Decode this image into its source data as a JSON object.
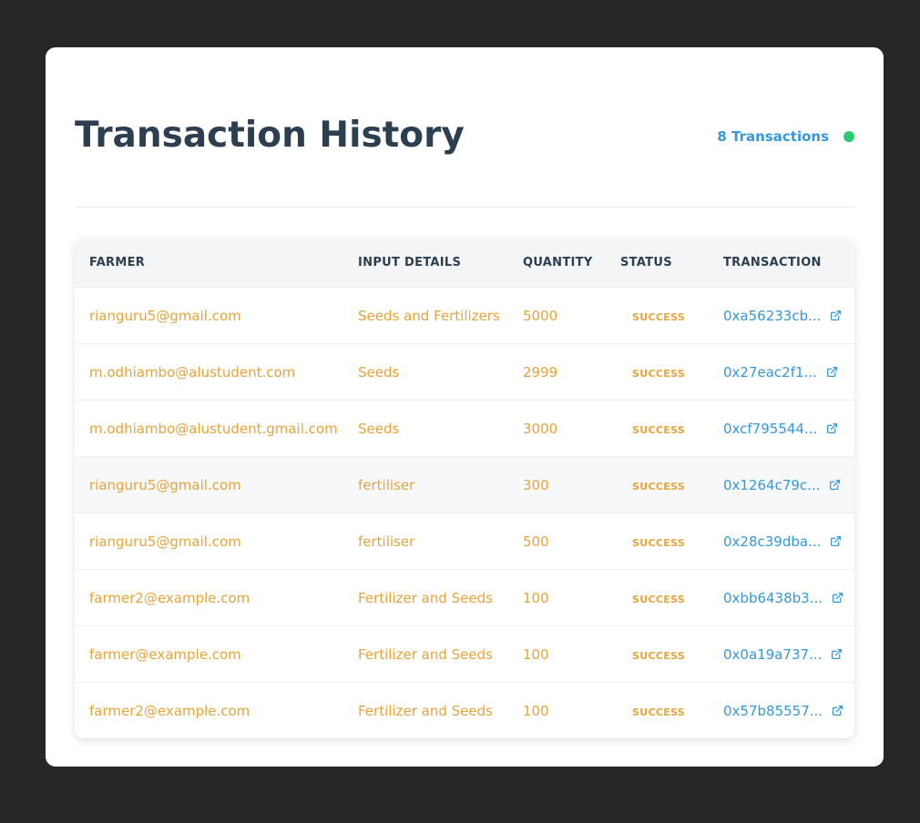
{
  "header": {
    "title": "Transaction History",
    "count_label": "8 Transactions"
  },
  "colors": {
    "page_bg": "#262626",
    "card_bg": "#ffffff",
    "title": "#2c3e50",
    "accent_blue": "#3498db",
    "accent_orange": "#e8a33a",
    "status_dot": "#2ecc71"
  },
  "table": {
    "columns": [
      "FARMER",
      "INPUT DETAILS",
      "QUANTITY",
      "STATUS",
      "TRANSACTION"
    ],
    "rows": [
      {
        "farmer": "rianguru5@gmail.com",
        "input": "Seeds and Fertilizers",
        "quantity": "5000",
        "status": "SUCCESS",
        "tx": "0xa56233cb..."
      },
      {
        "farmer": "m.odhiambo@alustudent.com",
        "input": "Seeds",
        "quantity": "2999",
        "status": "SUCCESS",
        "tx": "0x27eac2f1..."
      },
      {
        "farmer": "m.odhiambo@alustudent.gmail.com",
        "input": "Seeds",
        "quantity": "3000",
        "status": "SUCCESS",
        "tx": "0xcf795544..."
      },
      {
        "farmer": "rianguru5@gmail.com",
        "input": "fertiliser",
        "quantity": "300",
        "status": "SUCCESS",
        "tx": "0x1264c79c..."
      },
      {
        "farmer": "rianguru5@gmail.com",
        "input": "fertiliser",
        "quantity": "500",
        "status": "SUCCESS",
        "tx": "0x28c39dba..."
      },
      {
        "farmer": "farmer2@example.com",
        "input": "Fertilizer and Seeds",
        "quantity": "100",
        "status": "SUCCESS",
        "tx": "0xbb6438b3..."
      },
      {
        "farmer": "farmer@example.com",
        "input": "Fertilizer and Seeds",
        "quantity": "100",
        "status": "SUCCESS",
        "tx": "0x0a19a737..."
      },
      {
        "farmer": "farmer2@example.com",
        "input": "Fertilizer and Seeds",
        "quantity": "100",
        "status": "SUCCESS",
        "tx": "0x57b85557..."
      }
    ],
    "row_icon": "external-link-icon"
  }
}
